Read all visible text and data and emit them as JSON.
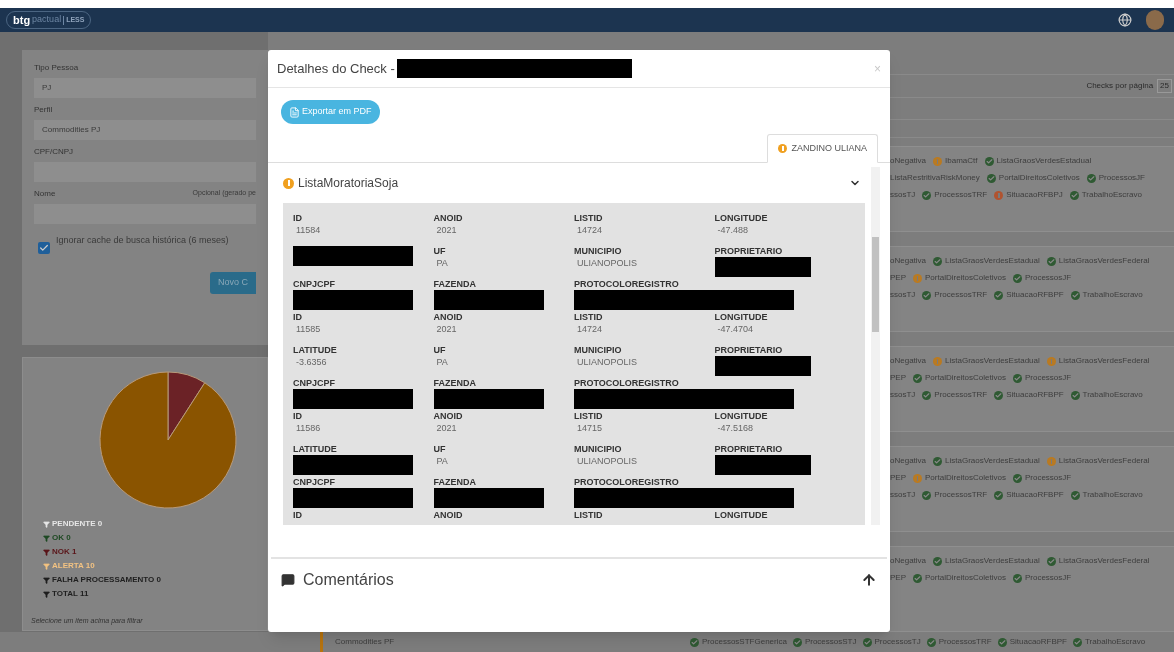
{
  "header": {
    "logo_main": "btg",
    "logo_sub": "pactual",
    "logo_product": "LESS"
  },
  "form": {
    "fields": [
      {
        "label": "Tipo Pessoa",
        "value": "PJ"
      },
      {
        "label": "Perfil",
        "value": "Commodities PJ"
      },
      {
        "label": "CPF/CNPJ"
      },
      {
        "label": "Nome",
        "hint": "Opcional (gerado pe"
      }
    ],
    "checkbox": {
      "label": "Ignorar cache de busca histórica (6 meses)",
      "checked": true
    },
    "submit": "Novo C"
  },
  "status_panel": {
    "chart_data": {
      "type": "pie",
      "categories": [
        "PENDENTE 0",
        "OK 0",
        "NOK 1",
        "ALERTA 10",
        "FALHA PROCESSAMENTO 0"
      ],
      "values": [
        0,
        0,
        1,
        10,
        0
      ]
    },
    "legend": [
      {
        "color": "#e6e6e6"
      },
      {
        "color": "#1f4a24"
      },
      {
        "color": "#5a1519"
      },
      {
        "color": "#f2c282"
      },
      {
        "color": "#1f1f1f"
      }
    ],
    "total": "TOTAL 11",
    "hint": "Selecione um item acima para filtrar"
  },
  "list": {
    "per_page_label": "Checks por página",
    "per_page_value": "25",
    "cards": [
      {
        "lines": [
          [
            {
              "text": "oNegativa",
              "kind": "plain"
            },
            {
              "text": "IbamaCtf",
              "kind": "alert"
            },
            {
              "text": "ListaGraosVerdesEstadual",
              "kind": "ok"
            }
          ],
          [
            {
              "text": "ListaRestritivaRiskMoney",
              "kind": "plain"
            },
            {
              "text": "PortalDireitosColetivos",
              "kind": "ok"
            },
            {
              "text": "ProcessosJF",
              "kind": "ok"
            }
          ],
          [
            {
              "text": "ssosTJ",
              "kind": "plain"
            },
            {
              "text": "ProcessosTRF",
              "kind": "ok"
            },
            {
              "text": "SituacaoRFBPJ",
              "kind": "error"
            },
            {
              "text": "TrabalhoEscravo",
              "kind": "ok"
            }
          ]
        ]
      },
      {
        "lines": [
          [
            {
              "text": "oNegativa",
              "kind": "plain"
            },
            {
              "text": "ListaGraosVerdesEstadual",
              "kind": "ok"
            },
            {
              "text": "ListaGraosVerdesFederal",
              "kind": "ok"
            }
          ],
          [
            {
              "text": "PEP",
              "kind": "plain"
            },
            {
              "text": "PortalDireitosColetivos",
              "kind": "alert"
            },
            {
              "text": "ProcessosJF",
              "kind": "ok"
            }
          ],
          [
            {
              "text": "ssosTJ",
              "kind": "plain"
            },
            {
              "text": "ProcessosTRF",
              "kind": "ok"
            },
            {
              "text": "SituacaoRFBPF",
              "kind": "ok"
            },
            {
              "text": "TrabalhoEscravo",
              "kind": "ok"
            }
          ]
        ]
      },
      {
        "lines": [
          [
            {
              "text": "oNegativa",
              "kind": "plain"
            },
            {
              "text": "ListaGraosVerdesEstadual",
              "kind": "alert"
            },
            {
              "text": "ListaGraosVerdesFederal",
              "kind": "alert"
            }
          ],
          [
            {
              "text": "PEP",
              "kind": "plain"
            },
            {
              "text": "PortalDireitosColetivos",
              "kind": "ok"
            },
            {
              "text": "ProcessosJF",
              "kind": "ok"
            }
          ],
          [
            {
              "text": "ssosTJ",
              "kind": "plain"
            },
            {
              "text": "ProcessosTRF",
              "kind": "ok"
            },
            {
              "text": "SituacaoRFBPF",
              "kind": "ok"
            },
            {
              "text": "TrabalhoEscravo",
              "kind": "ok"
            }
          ]
        ]
      },
      {
        "lines": [
          [
            {
              "text": "oNegativa",
              "kind": "plain"
            },
            {
              "text": "ListaGraosVerdesEstadual",
              "kind": "ok"
            },
            {
              "text": "ListaGraosVerdesFederal",
              "kind": "alert"
            }
          ],
          [
            {
              "text": "PEP",
              "kind": "plain"
            },
            {
              "text": "PortalDireitosColetivos",
              "kind": "alert"
            },
            {
              "text": "ProcessosJF",
              "kind": "ok"
            }
          ],
          [
            {
              "text": "ssosTJ",
              "kind": "plain"
            },
            {
              "text": "ProcessosTRF",
              "kind": "ok"
            },
            {
              "text": "SituacaoRFBPF",
              "kind": "ok"
            },
            {
              "text": "TrabalhoEscravo",
              "kind": "ok"
            }
          ]
        ]
      },
      {
        "lines": [
          [
            {
              "text": "oNegativa",
              "kind": "plain"
            },
            {
              "text": "ListaGraosVerdesEstadual",
              "kind": "ok"
            },
            {
              "text": "ListaGraosVerdesFederal",
              "kind": "ok"
            }
          ],
          [
            {
              "text": "PEP",
              "kind": "plain"
            },
            {
              "text": "PortalDireitosColetivos",
              "kind": "ok"
            },
            {
              "text": "ProcessosJF",
              "kind": "ok"
            }
          ]
        ]
      }
    ],
    "bottom_card": {
      "profile": "Commodities PF",
      "tags": [
        {
          "text": "ProcessosSTFGenerica",
          "kind": "ok"
        },
        {
          "text": "ProcessosSTJ",
          "kind": "ok"
        },
        {
          "text": "ProcessosTJ",
          "kind": "ok"
        },
        {
          "text": "ProcessosTRF",
          "kind": "ok"
        },
        {
          "text": "SituacaoRFBPF",
          "kind": "ok"
        },
        {
          "text": "TrabalhoEscravo",
          "kind": "ok"
        }
      ]
    }
  },
  "modal": {
    "title": "Detalhes do Check -",
    "title_redacted": true,
    "close": "×",
    "export_button": "Exportar em PDF",
    "tabs": [
      {
        "label": "ZANDINO ULIANA",
        "selected": true
      }
    ],
    "section": {
      "title": "ListaMoratoriaSoja",
      "expanded": true,
      "records": [
        {
          "fields": [
            {
              "label": "ID",
              "value": "11584"
            },
            {
              "label": "ANOID",
              "value": "2021"
            },
            {
              "label": "LISTID",
              "value": "14724"
            },
            {
              "label": "LONGITUDE",
              "value": "-47.488"
            },
            {
              "redacted": true
            },
            {
              "label": "UF",
              "value": "PA"
            },
            {
              "label": "MUNICIPIO",
              "value": "ULIANOPOLIS"
            },
            {
              "label": "PROPRIETARIO",
              "redacted": true
            },
            {
              "label": "CNPJCPF",
              "redacted": true
            },
            {
              "label": "FAZENDA",
              "redacted": true
            },
            {
              "label": "PROTOCOLOREGISTRO",
              "redacted": true
            }
          ]
        },
        {
          "fields": [
            {
              "label": "ID",
              "value": "11585"
            },
            {
              "label": "ANOID",
              "value": "2021"
            },
            {
              "label": "LISTID",
              "value": "14724"
            },
            {
              "label": "LONGITUDE",
              "value": "-47.4704"
            },
            {
              "label": "LATITUDE",
              "value": "-3.6356"
            },
            {
              "label": "UF",
              "value": "PA"
            },
            {
              "label": "MUNICIPIO",
              "value": "ULIANOPOLIS"
            },
            {
              "label": "PROPRIETARIO",
              "redacted": true
            },
            {
              "label": "CNPJCPF",
              "redacted": true
            },
            {
              "label": "FAZENDA",
              "redacted": true
            },
            {
              "label": "PROTOCOLOREGISTRO",
              "redacted": true
            }
          ]
        },
        {
          "fields": [
            {
              "label": "ID",
              "value": "11586"
            },
            {
              "label": "ANOID",
              "value": "2021"
            },
            {
              "label": "LISTID",
              "value": "14715"
            },
            {
              "label": "LONGITUDE",
              "value": "-47.5168"
            },
            {
              "label": "LATITUDE",
              "redacted": true
            },
            {
              "label": "UF",
              "value": "PA"
            },
            {
              "label": "MUNICIPIO",
              "value": "ULIANOPOLIS"
            },
            {
              "label": "PROPRIETARIO",
              "redacted": true
            },
            {
              "label": "CNPJCPF",
              "redacted": true
            },
            {
              "label": "FAZENDA",
              "redacted": true
            },
            {
              "label": "PROTOCOLOREGISTRO",
              "redacted": true
            }
          ]
        },
        {
          "fields": [
            {
              "label": "ID"
            },
            {
              "label": "ANOID"
            },
            {
              "label": "LISTID"
            },
            {
              "label": "LONGITUDE"
            }
          ]
        }
      ]
    },
    "comments": {
      "title": "Comentários",
      "expanded": false
    }
  }
}
